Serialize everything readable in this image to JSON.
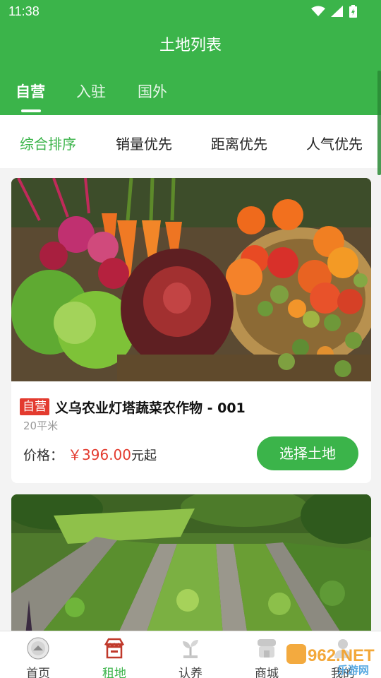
{
  "status_bar": {
    "time": "11:38"
  },
  "header": {
    "title": "土地列表"
  },
  "tabs": [
    {
      "label": "自营",
      "active": true
    },
    {
      "label": "入驻",
      "active": false
    },
    {
      "label": "国外",
      "active": false
    }
  ],
  "sort_options": [
    {
      "label": "综合排序",
      "active": true
    },
    {
      "label": "销量优先",
      "active": false
    },
    {
      "label": "距离优先",
      "active": false
    },
    {
      "label": "人气优先",
      "active": false
    }
  ],
  "listings": [
    {
      "badge": "自营",
      "title": "义乌农业灯塔蔬菜农作物 - 001",
      "area": "20平米",
      "price_label": "价格：",
      "price": "￥396.00",
      "price_suffix": "元起",
      "action": "选择土地"
    }
  ],
  "bottom_nav": [
    {
      "label": "首页",
      "icon": "home-badge-icon",
      "active": false
    },
    {
      "label": "租地",
      "icon": "shop-icon",
      "active": true
    },
    {
      "label": "认养",
      "icon": "plant-icon",
      "active": false
    },
    {
      "label": "商城",
      "icon": "store-icon",
      "active": false
    },
    {
      "label": "我的",
      "icon": "user-icon",
      "active": false
    }
  ],
  "watermark": {
    "text": "962.NET",
    "subtext": "乐游网"
  },
  "colors": {
    "primary": "#3bb44a",
    "price": "#e33b2f",
    "badge": "#e33b2f"
  }
}
